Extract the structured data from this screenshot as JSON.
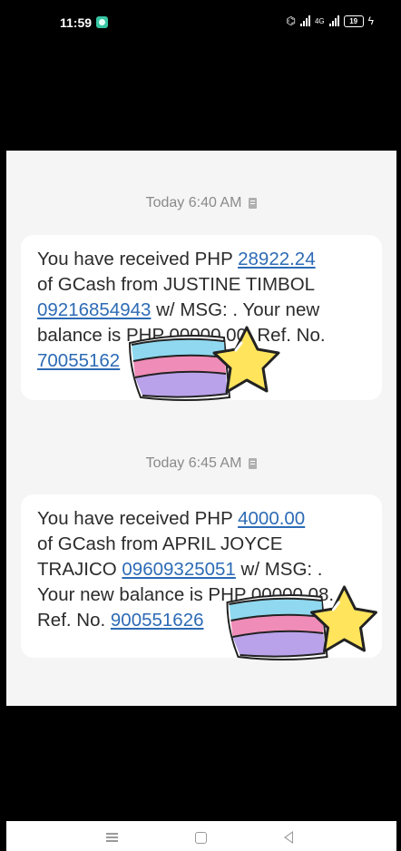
{
  "status_bar": {
    "time": "11:59",
    "network": "4G",
    "battery": "19"
  },
  "messages": [
    {
      "timestamp": "Today 6:40 AM",
      "line1": {
        "prefix": "You have received PHP ",
        "amount": "28922.24"
      },
      "line2": {
        "text": "of GCash from JUSTINE TIMBOL"
      },
      "line3": {
        "number": "09216854943",
        "suffix": " w/ MSG: . Your new"
      },
      "line4": {
        "text": "balance is PHP 00000.00. Ref. No."
      },
      "line5": {
        "ref": "70055162"
      }
    },
    {
      "timestamp": "Today 6:45 AM",
      "line1": {
        "prefix": "You have received PHP ",
        "amount": "4000.00"
      },
      "line2": {
        "text": "of GCash from APRIL JOYCE"
      },
      "line3": {
        "prefix": "TRAJICO ",
        "number": "09609325051",
        "suffix": " w/ MSG: ."
      },
      "line4": {
        "text": "Your new balance is PHP 00000.08."
      },
      "line5": {
        "prefix": "Ref. No. ",
        "ref": "900551626"
      }
    }
  ],
  "colors": {
    "link": "#2d6bb5",
    "sticker_pink": "#f08cb8",
    "sticker_blue": "#8fd8f0",
    "sticker_purple": "#b9a2ea",
    "sticker_star": "#ffe45c"
  }
}
